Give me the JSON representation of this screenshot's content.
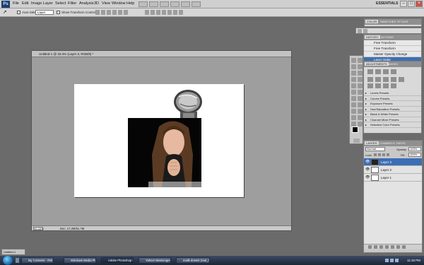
{
  "app": {
    "logo": "Ps",
    "workspace": "ESSENTIALS",
    "menu": [
      "File",
      "Edit",
      "Image",
      "Layer",
      "Select",
      "Filter",
      "Analysis",
      "3D",
      "View",
      "Window",
      "Help"
    ],
    "window_controls": [
      "–",
      "□",
      "×"
    ]
  },
  "options_bar": {
    "auto_select_label": "Auto-Select:",
    "auto_select_value": "Layer",
    "show_transform_label": "Show Transform Controls"
  },
  "document": {
    "title": "Untitled-1 @ 33.3% (Layer 3, RGB/8) *",
    "zoom": "33.33%",
    "doc_info": "Doc: 17.2M/51.7M"
  },
  "history_panel": {
    "tabs": [
      "HISTORY",
      "ACTIONS"
    ],
    "items": [
      {
        "label": "Free Transform",
        "active": false
      },
      {
        "label": "Free Transform",
        "active": false
      },
      {
        "label": "Master Opacity Change",
        "active": false
      },
      {
        "label": "Layer Order",
        "active": true
      }
    ]
  },
  "color_panel": {
    "tabs": [
      "COLOR",
      "SWATCHES",
      "STYLES"
    ]
  },
  "adjustments_panel": {
    "tabs": [
      "ADJUSTMENTS",
      "MASKS"
    ],
    "presets": [
      "Levels Presets",
      "Curves Presets",
      "Exposure Presets",
      "Hue/Saturation Presets",
      "Black & White Presets",
      "Channel Mixer Presets",
      "Selective Color Presets"
    ]
  },
  "layers_panel": {
    "tabs": [
      "LAYERS",
      "CHANNELS",
      "PATHS"
    ],
    "blend_mode": "Normal",
    "opacity_label": "Opacity:",
    "opacity": "100%",
    "lock_label": "Lock:",
    "fill_label": "Fill:",
    "fill": "100%",
    "layers": [
      {
        "name": "Layer 3",
        "active": true
      },
      {
        "name": "Layer 2",
        "active": false
      },
      {
        "name": "Layer 1",
        "active": false
      }
    ]
  },
  "minimized_doc": {
    "label": "Untitled-1"
  },
  "taskbar": {
    "items": [
      {
        "label": "My Contents - RSI by...",
        "active": false
      },
      {
        "label": "Windows Media Player",
        "active": false
      },
      {
        "label": "Adobe Photoshop C...",
        "active": true
      },
      {
        "label": "Yahoo! Messenger",
        "active": false
      },
      {
        "label": "malik doesnt (real_re...",
        "active": false
      }
    ],
    "clock": "11:18 PM"
  },
  "colors": {
    "accent": "#3d6eb4",
    "workspace_bg": "#6b6b6b"
  }
}
